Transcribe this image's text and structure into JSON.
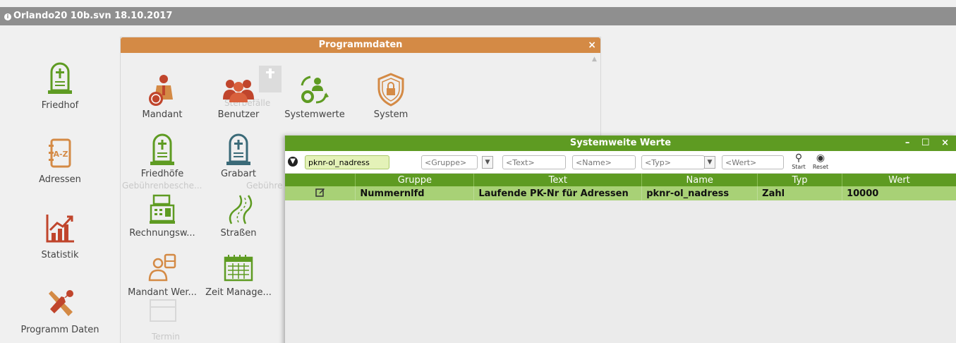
{
  "app": {
    "title": "Orlando20 10b.svn 18.10.2017"
  },
  "sidebar": {
    "items": [
      {
        "label": "Friedhof",
        "icon": "gravestone-icon"
      },
      {
        "label": "Adressen",
        "icon": "address-book-icon"
      },
      {
        "label": "Statistik",
        "icon": "chart-icon"
      },
      {
        "label": "Programm Daten",
        "icon": "tools-icon"
      }
    ]
  },
  "programmdaten": {
    "title": "Programmdaten",
    "close": "×",
    "tiles": [
      {
        "label": "Mandant"
      },
      {
        "label": "Benutzer"
      },
      {
        "label": "Systemwerte"
      },
      {
        "label": "System"
      },
      {
        "label": "Friedhöfe"
      },
      {
        "label": "Grabart"
      },
      {
        "label": "Rechnungsw..."
      },
      {
        "label": "Straßen"
      },
      {
        "label": "Mandant Wer..."
      },
      {
        "label": "Zeit Manage..."
      }
    ],
    "ghost_labels": {
      "sterbefaelle": "Sterbefälle",
      "gebuehrenbesche": "Gebührenbesche...",
      "gebuehr": "Gebühre",
      "termin": "Termin"
    }
  },
  "systemwerte": {
    "title": "Systemweite Werte",
    "controls": "– ☐ ×",
    "filter": {
      "search_value": "pknr-ol_nadress",
      "gruppe_placeholder": "<Gruppe>",
      "text_placeholder": "<Text>",
      "name_placeholder": "<Name>",
      "typ_placeholder": "<Typ>",
      "wert_placeholder": "<Wert>",
      "start_label": "Start",
      "reset_label": "Reset"
    },
    "columns": [
      "",
      "Gruppe",
      "Text",
      "Name",
      "Typ",
      "Wert"
    ],
    "rows": [
      {
        "gruppe": "Nummernlfd",
        "text": "Laufende PK-Nr für Adressen",
        "name": "pknr-ol_nadress",
        "typ": "Zahl",
        "wert": "10000"
      }
    ]
  },
  "colors": {
    "accent_orange": "#d48a45",
    "accent_green": "#5e9b22",
    "row_green": "#a8d176"
  }
}
